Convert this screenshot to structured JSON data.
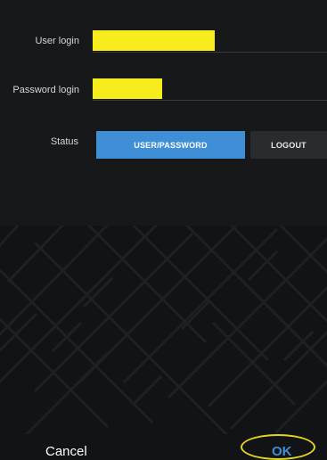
{
  "form": {
    "user_login_label": "User login",
    "password_login_label": "Password login",
    "status_label": "Status"
  },
  "status_options": {
    "active": "USER/PASSWORD",
    "inactive": "LOGOUT"
  },
  "footer": {
    "cancel_label": "Cancel",
    "ok_label": "OK"
  },
  "colors": {
    "accent": "#3f8fd6",
    "redaction": "#f7ec1c",
    "highlight_circle": "#e3d51d"
  }
}
